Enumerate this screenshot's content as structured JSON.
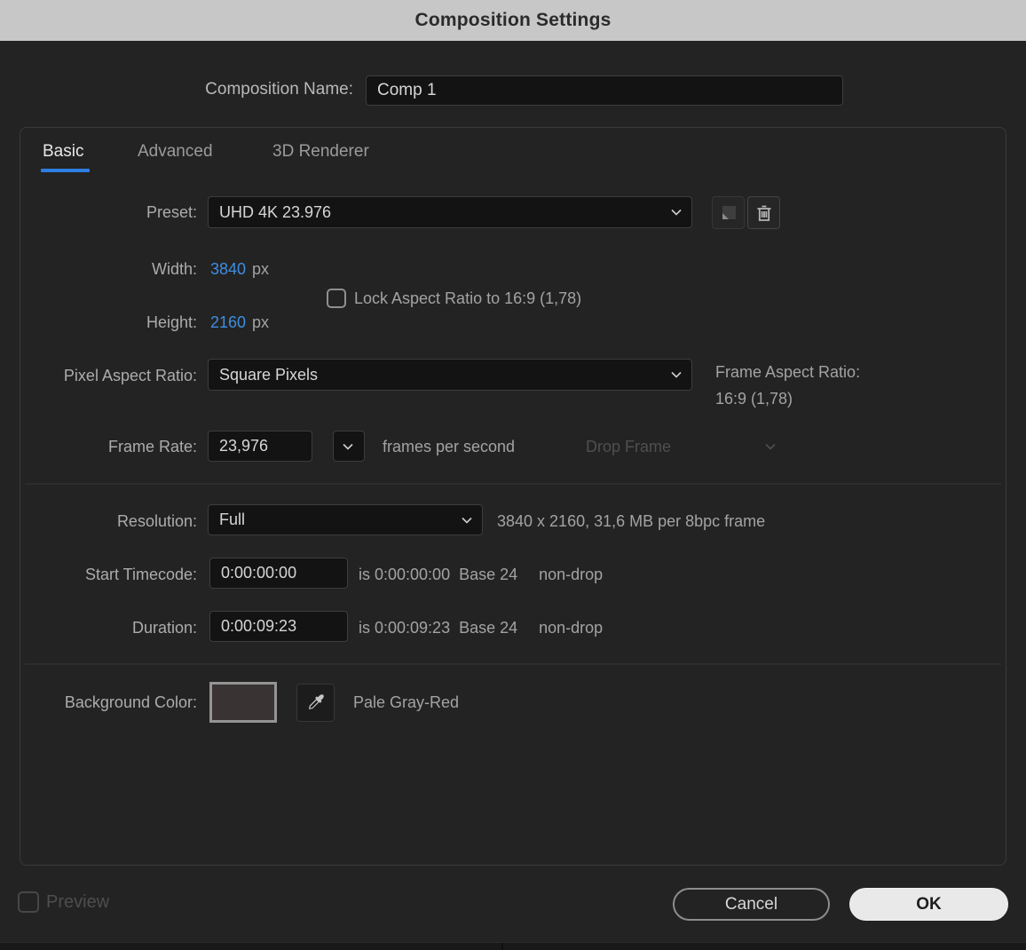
{
  "window": {
    "title": "Composition Settings"
  },
  "colors": {
    "accent_blue": "#2d7ee3",
    "value_blue": "#3f8ee0",
    "titlebar_gray": "#c7c7c7",
    "background_swatch": "#3a3333"
  },
  "name_row": {
    "label": "Composition Name:",
    "value": "Comp 1"
  },
  "tabs": {
    "items": [
      {
        "label": "Basic",
        "active": true
      },
      {
        "label": "Advanced",
        "active": false
      },
      {
        "label": "3D Renderer",
        "active": false
      }
    ]
  },
  "preset": {
    "label": "Preset:",
    "value": "UHD 4K 23.976",
    "save_icon": "save-preset-icon",
    "delete_icon": "trash-icon"
  },
  "dimensions": {
    "width_label": "Width:",
    "width_value": "3840",
    "width_unit": "px",
    "height_label": "Height:",
    "height_value": "2160",
    "height_unit": "px",
    "lock_label": "Lock Aspect Ratio to 16:9 (1,78)",
    "lock_checked": false
  },
  "pixel_aspect_ratio": {
    "label": "Pixel Aspect Ratio:",
    "value": "Square Pixels",
    "frame_aspect_label": "Frame Aspect Ratio:",
    "frame_aspect_value": "16:9 (1,78)"
  },
  "frame_rate": {
    "label": "Frame Rate:",
    "value": "23,976",
    "unit": "frames per second",
    "drop_frame_label": "Drop Frame",
    "drop_frame_enabled": false
  },
  "resolution": {
    "label": "Resolution:",
    "value": "Full",
    "info": "3840 x 2160, 31,6 MB per 8bpc frame"
  },
  "start_timecode": {
    "label": "Start Timecode:",
    "value": "0:00:00:00",
    "is_text": "is 0:00:00:00",
    "base_text": "Base 24",
    "drop_text": "non-drop"
  },
  "duration": {
    "label": "Duration:",
    "value": "0:00:09:23",
    "is_text": "is 0:00:09:23",
    "base_text": "Base 24",
    "drop_text": "non-drop"
  },
  "background_color": {
    "label": "Background Color:",
    "swatch_color": "#3a3333",
    "color_name": "Pale Gray-Red"
  },
  "footer": {
    "preview_label": "Preview",
    "preview_checked": false,
    "cancel_label": "Cancel",
    "ok_label": "OK"
  }
}
